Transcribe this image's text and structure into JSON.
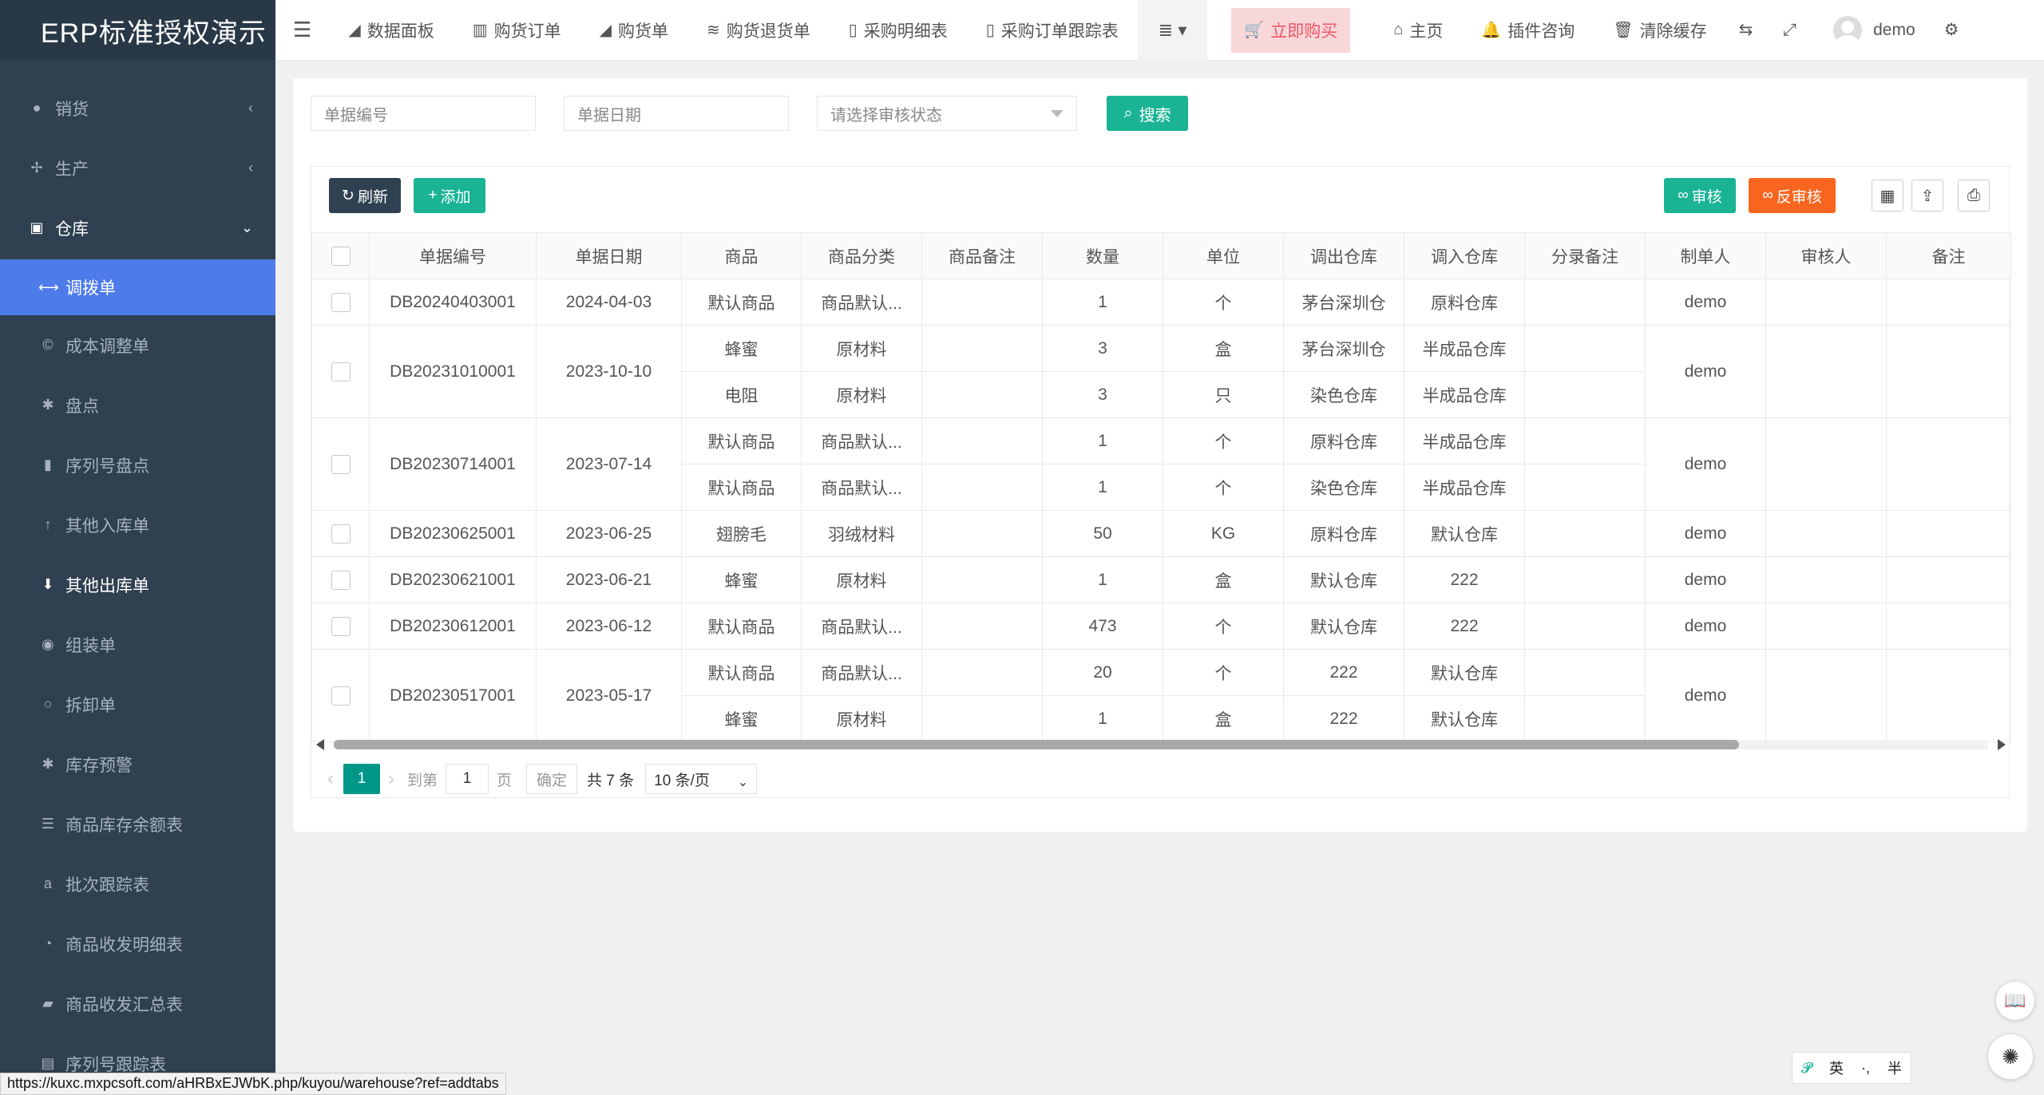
{
  "brand": "ERP标准授权演示",
  "sidebar": {
    "top": [
      {
        "label": "销货",
        "icon": "apple-icon"
      },
      {
        "label": "生产",
        "icon": "tools-icon"
      }
    ],
    "open": {
      "label": "仓库",
      "icon": "box-icon"
    },
    "subs": [
      {
        "label": "调拨单",
        "icon": "arrows-h-icon",
        "glyph": "⟷"
      },
      {
        "label": "成本调整单",
        "icon": "copyright-icon",
        "glyph": "©"
      },
      {
        "label": "盘点",
        "icon": "bug-icon",
        "glyph": "✱"
      },
      {
        "label": "序列号盘点",
        "icon": "barcode-icon",
        "glyph": "▮"
      },
      {
        "label": "其他入库单",
        "icon": "arrow-up-icon",
        "glyph": "↑"
      },
      {
        "label": "其他出库单",
        "icon": "arrow-circle-down-icon",
        "glyph": "⬇"
      },
      {
        "label": "组装单",
        "icon": "dot-circle-icon",
        "glyph": "◉"
      },
      {
        "label": "拆卸单",
        "icon": "ring-icon",
        "glyph": "○"
      },
      {
        "label": "库存预警",
        "icon": "bug-icon",
        "glyph": "✱"
      },
      {
        "label": "商品库存余额表",
        "icon": "css3-icon",
        "glyph": "☰"
      },
      {
        "label": "批次跟踪表",
        "icon": "amazon-icon",
        "glyph": "a"
      },
      {
        "label": "商品收发明细表",
        "icon": "tachometer-icon",
        "glyph": "◔"
      },
      {
        "label": "商品收发汇总表",
        "icon": "eraser-icon",
        "glyph": "▰"
      },
      {
        "label": "序列号跟踪表",
        "icon": "file-icon",
        "glyph": "▤"
      }
    ]
  },
  "header": {
    "tabs": [
      {
        "label": "数据面板",
        "icon": "area-chart-icon",
        "glyph": "◢"
      },
      {
        "label": "购货订单",
        "icon": "bar-chart-icon",
        "glyph": "▥"
      },
      {
        "label": "购货单",
        "icon": "area-chart-icon",
        "glyph": "◢"
      },
      {
        "label": "购货退货单",
        "icon": "database-icon",
        "glyph": "≋"
      },
      {
        "label": "采购明细表",
        "icon": "file-text-icon",
        "glyph": "▯"
      },
      {
        "label": "采购订单跟踪表",
        "icon": "file-text-icon",
        "glyph": "▯"
      }
    ],
    "buy": "立即购买",
    "home": "主页",
    "plugin": "插件咨询",
    "clear_cache": "清除缓存",
    "user": "demo"
  },
  "search": {
    "bill_no_placeholder": "单据编号",
    "bill_date_placeholder": "单据日期",
    "status_placeholder": "请选择审核状态",
    "button": "搜索"
  },
  "toolbar": {
    "refresh": "刷新",
    "add": "添加",
    "audit": "审核",
    "unaudit": "反审核"
  },
  "table": {
    "columns": [
      "单据编号",
      "单据日期",
      "商品",
      "商品分类",
      "商品备注",
      "数量",
      "单位",
      "调出仓库",
      "调入仓库",
      "分录备注",
      "制单人",
      "审核人",
      "备注"
    ],
    "rows": [
      {
        "no": "DB20240403001",
        "date": "2024-04-03",
        "maker": "demo",
        "items": [
          {
            "goods": "默认商品",
            "cat": "商品默认...",
            "qty": "1",
            "unit": "个",
            "out": "茅台深圳仓",
            "in": "原料仓库"
          }
        ]
      },
      {
        "no": "DB20231010001",
        "date": "2023-10-10",
        "maker": "demo",
        "items": [
          {
            "goods": "蜂蜜",
            "cat": "原材料",
            "qty": "3",
            "unit": "盒",
            "out": "茅台深圳仓",
            "in": "半成品仓库"
          },
          {
            "goods": "电阻",
            "cat": "原材料",
            "qty": "3",
            "unit": "只",
            "out": "染色仓库",
            "in": "半成品仓库"
          }
        ]
      },
      {
        "no": "DB20230714001",
        "date": "2023-07-14",
        "maker": "demo",
        "items": [
          {
            "goods": "默认商品",
            "cat": "商品默认...",
            "qty": "1",
            "unit": "个",
            "out": "原料仓库",
            "in": "半成品仓库"
          },
          {
            "goods": "默认商品",
            "cat": "商品默认...",
            "qty": "1",
            "unit": "个",
            "out": "染色仓库",
            "in": "半成品仓库"
          }
        ]
      },
      {
        "no": "DB20230625001",
        "date": "2023-06-25",
        "maker": "demo",
        "items": [
          {
            "goods": "翅膀毛",
            "cat": "羽绒材料",
            "qty": "50",
            "unit": "KG",
            "out": "原料仓库",
            "in": "默认仓库"
          }
        ]
      },
      {
        "no": "DB20230621001",
        "date": "2023-06-21",
        "maker": "demo",
        "items": [
          {
            "goods": "蜂蜜",
            "cat": "原材料",
            "qty": "1",
            "unit": "盒",
            "out": "默认仓库",
            "in": "222"
          }
        ]
      },
      {
        "no": "DB20230612001",
        "date": "2023-06-12",
        "maker": "demo",
        "items": [
          {
            "goods": "默认商品",
            "cat": "商品默认...",
            "qty": "473",
            "unit": "个",
            "out": "默认仓库",
            "in": "222"
          }
        ]
      },
      {
        "no": "DB20230517001",
        "date": "2023-05-17",
        "maker": "demo",
        "items": [
          {
            "goods": "默认商品",
            "cat": "商品默认...",
            "qty": "20",
            "unit": "个",
            "out": "222",
            "in": "默认仓库"
          },
          {
            "goods": "蜂蜜",
            "cat": "原材料",
            "qty": "1",
            "unit": "盒",
            "out": "222",
            "in": "默认仓库"
          }
        ]
      }
    ]
  },
  "pager": {
    "current": "1",
    "goto_label": "到第",
    "goto_value": "1",
    "page_label": "页",
    "confirm": "确定",
    "total": "共 7 条",
    "per_page": "10 条/页"
  },
  "statusbar": "https://kuxc.mxpcsoft.com/aHRBxEJWbK.php/kuyou/warehouse?ref=addtabs",
  "ime": {
    "mode": "英",
    "punct": "·,",
    "width": "半"
  },
  "colors": {
    "sidebar": "#2f4050",
    "active": "#4e7bea",
    "primary": "#1ab394",
    "warning": "#f8651e",
    "danger": "#ed5565"
  }
}
